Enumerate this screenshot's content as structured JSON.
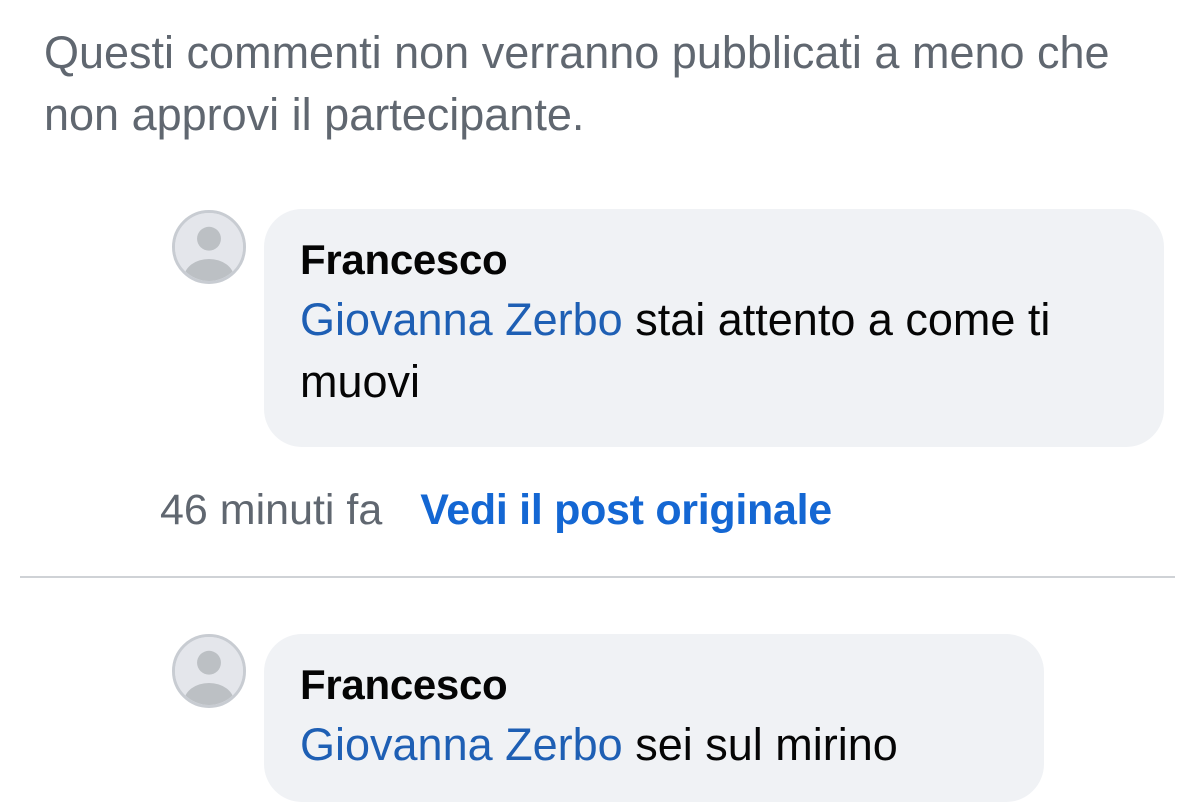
{
  "notice": "Questi commenti non verranno pubblicati a meno che non approvi il partecipante.",
  "comments": [
    {
      "avatar_icon": "default-avatar-icon",
      "author": "Francesco",
      "mention": "Giovanna Zerbo",
      "text": " stai attento a come ti muovi",
      "time": "46 minuti fa",
      "link": "Vedi il post originale"
    },
    {
      "avatar_icon": "default-avatar-icon",
      "author": "Francesco",
      "mention": "Giovanna Zerbo",
      "text": " sei sul mirino"
    }
  ],
  "colors": {
    "mention": "#1e5fb4",
    "link": "#1467d3",
    "bubble": "#f0f2f5",
    "muted_text": "#606770"
  }
}
